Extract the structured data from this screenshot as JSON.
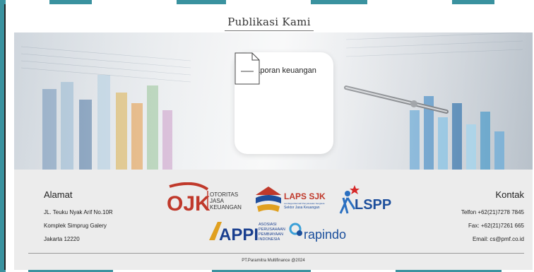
{
  "section_title": "Publikasi Kami",
  "card": {
    "title": "Laporan keuangan",
    "icon": "document-icon"
  },
  "footer": {
    "address_heading": "Alamat",
    "address_lines": [
      "JL. Teuku Nyak Arif No.10R",
      "Komplek Simprug Galery",
      "Jakarta 12220"
    ],
    "contact_heading": "Kontak",
    "contact_lines": [
      "Telfon +62(21)7278 7845",
      "Fax: +62(21)7261 665",
      "Email: cs@pmf.co.id"
    ],
    "copyright": "PT.Paramitra Multifinance @2024",
    "logos": {
      "ojk": {
        "mark": "OJK",
        "line1": "OTORITAS",
        "line2": "JASA",
        "line3": "KEUANGAN"
      },
      "laps": {
        "name": "LAPS SJK",
        "sub1": "Lembaga Alternatif Penyelesaian Sengketa",
        "sub2": "Sektor Jasa Keuangan"
      },
      "lsppi": {
        "name": "LSPPI"
      },
      "appi": {
        "name": "APPI",
        "line1": "ASOSIASI",
        "line2": "PERUSAHAAN",
        "line3": "PEMBIAYAAN",
        "line4": "INDONESIA"
      },
      "rapindo": {
        "name": "rapindo"
      }
    }
  },
  "colors": {
    "watermark": "#2f8c9a",
    "ojk_red": "#c0392b",
    "laps_blue": "#1f4e9b",
    "appi_blue": "#1a3f8f",
    "rapindo_blue": "#1b4f9c"
  }
}
